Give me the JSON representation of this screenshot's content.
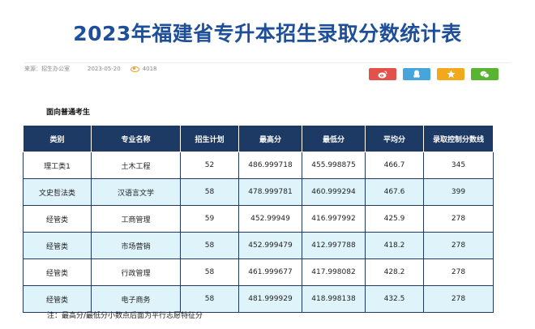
{
  "title": "2023年福建省专升本招生录取分数统计表",
  "meta": {
    "source": "来源：招生办公室",
    "date": "2023-05-20",
    "views": "4018"
  },
  "share_icons": [
    "weibo-icon",
    "qq-icon",
    "star-icon",
    "wechat-icon"
  ],
  "section_heading": "面向普通考生",
  "table": {
    "headers": [
      "类别",
      "专业名称",
      "招生计划",
      "最高分",
      "最低分",
      "平均分",
      "录取控制分数线"
    ],
    "rows": [
      [
        "理工类1",
        "土木工程",
        "52",
        "486.999718",
        "455.998875",
        "466.7",
        "345"
      ],
      [
        "文史哲法类",
        "汉语言文学",
        "58",
        "478.999781",
        "460.999294",
        "467.6",
        "399"
      ],
      [
        "经管类",
        "工商管理",
        "59",
        "452.99949",
        "416.997992",
        "425.9",
        "278"
      ],
      [
        "经管类",
        "市场营销",
        "58",
        "452.999479",
        "412.997788",
        "418.2",
        "278"
      ],
      [
        "经管类",
        "行政管理",
        "58",
        "461.999677",
        "417.998082",
        "428.2",
        "278"
      ],
      [
        "经管类",
        "电子商务",
        "58",
        "481.999929",
        "418.998138",
        "432.5",
        "278"
      ]
    ]
  },
  "note": "注：最高分/最低分小数点后面为平行志愿特征分",
  "colors": {
    "title": "#1f4f99",
    "header_bg": "#1c3a63",
    "stripe": "#dff3fb"
  }
}
